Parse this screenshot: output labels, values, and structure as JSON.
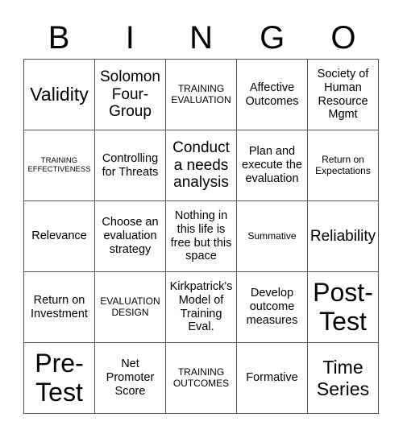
{
  "header": {
    "letters": [
      "B",
      "I",
      "N",
      "G",
      "O"
    ]
  },
  "cells": [
    {
      "text": "Validity",
      "size": "xl"
    },
    {
      "text": "Solomon Four-Group",
      "size": "l"
    },
    {
      "text": "TRAINING EVALUATION",
      "size": "s"
    },
    {
      "text": "Affective Outcomes",
      "size": "m"
    },
    {
      "text": "Society of Human Resource Mgmt",
      "size": "m"
    },
    {
      "text": "TRAINING EFFECTIVENESS",
      "size": "xs"
    },
    {
      "text": "Controlling for Threats",
      "size": "m"
    },
    {
      "text": "Conduct a needs analysis",
      "size": "l"
    },
    {
      "text": "Plan and execute the evaluation",
      "size": "m"
    },
    {
      "text": "Return on Expectations",
      "size": "s"
    },
    {
      "text": "Relevance",
      "size": "m"
    },
    {
      "text": "Choose an evaluation strategy",
      "size": "m"
    },
    {
      "text": "Nothing in this life is free but this space",
      "size": "m"
    },
    {
      "text": "Summative",
      "size": "s"
    },
    {
      "text": "Reliability",
      "size": "l"
    },
    {
      "text": "Return on Investment",
      "size": "m"
    },
    {
      "text": "EVALUATION DESIGN",
      "size": "s"
    },
    {
      "text": "Kirkpatrick's Model of Training Eval.",
      "size": "m"
    },
    {
      "text": "Develop outcome measures",
      "size": "m"
    },
    {
      "text": "Post-Test",
      "size": "xxl"
    },
    {
      "text": "Pre-Test",
      "size": "xxl"
    },
    {
      "text": "Net Promoter Score",
      "size": "m"
    },
    {
      "text": "TRAINING OUTCOMES",
      "size": "s"
    },
    {
      "text": "Formative",
      "size": "m"
    },
    {
      "text": "Time Series",
      "size": "xl"
    }
  ]
}
